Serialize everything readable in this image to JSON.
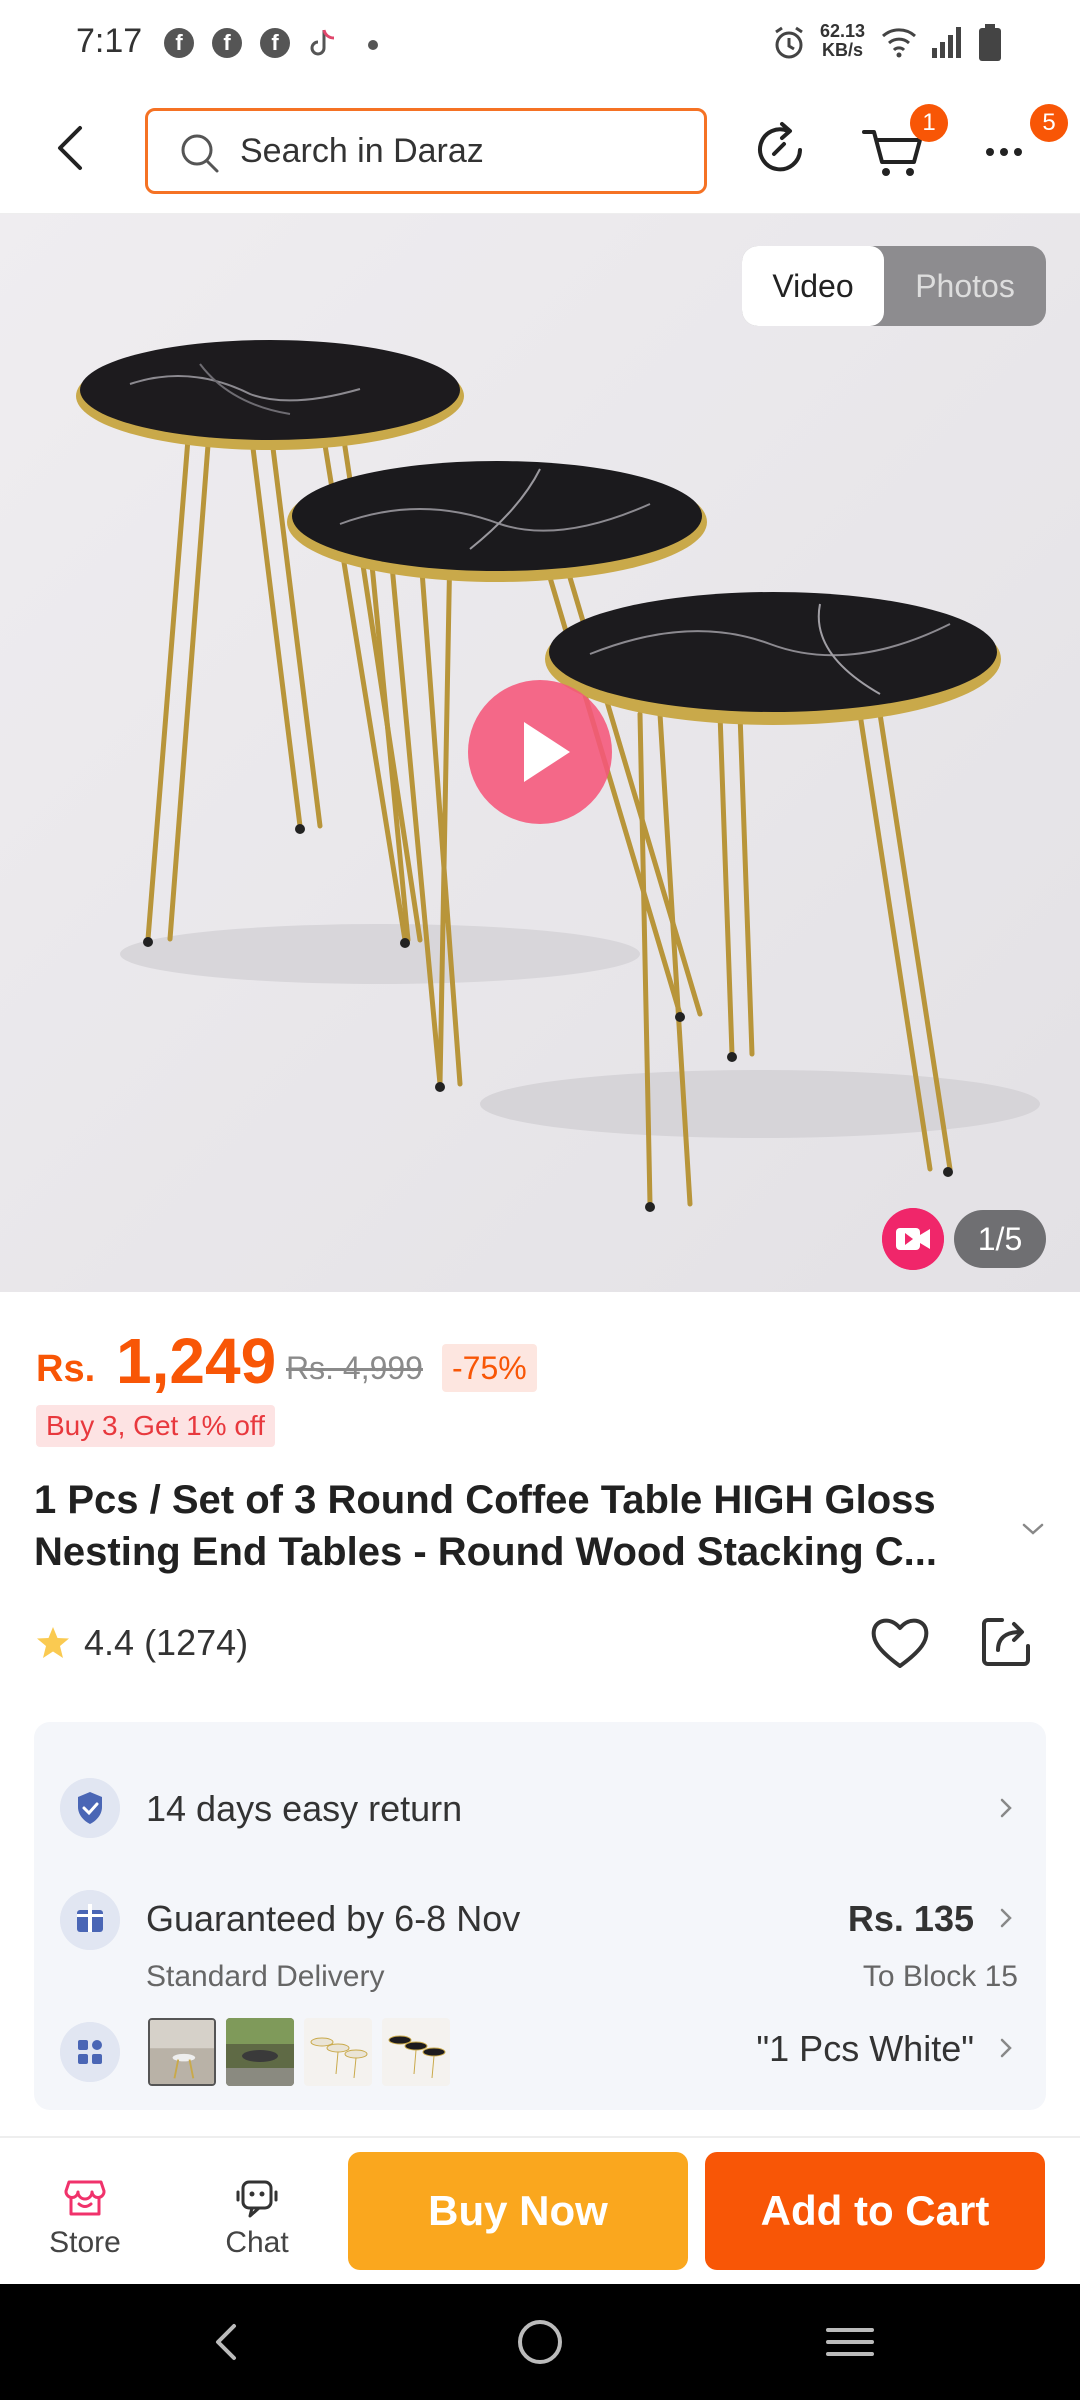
{
  "status_bar": {
    "time": "7:17",
    "net_speed_value": "62.13",
    "net_speed_unit": "KB/s",
    "notification_icons": [
      "facebook-icon",
      "facebook-icon",
      "facebook-icon",
      "tiktok-icon"
    ]
  },
  "header": {
    "search_placeholder": "Search in Daraz",
    "cart_badge": "1",
    "more_badge": "5"
  },
  "gallery": {
    "tab_video": "Video",
    "tab_photos": "Photos",
    "active_tab": "Video",
    "counter": "1/5"
  },
  "product": {
    "currency": "Rs.",
    "price": "1,249",
    "original_price": "Rs. 4,999",
    "discount": "-75%",
    "promo": "Buy 3, Get 1% off",
    "title": "1 Pcs / Set of 3 Round Coffee Table HIGH Gloss Nesting End Tables - Round Wood Stacking C...",
    "rating_value": "4.4",
    "rating_count": "(1274)"
  },
  "services": {
    "return_text": "14 days easy return",
    "delivery_text": "Guaranteed by 6-8 Nov",
    "delivery_sub": "Standard Delivery",
    "delivery_price": "Rs. 135",
    "delivery_to": "To Block 15",
    "variant_selected": "\"1 Pcs White\""
  },
  "actions": {
    "store_label": "Store",
    "chat_label": "Chat",
    "buy_now_label": "Buy Now",
    "add_to_cart_label": "Add to Cart"
  },
  "colors": {
    "brand_orange": "#f85606",
    "buy_now_yellow": "#faa71e",
    "play_pink": "#f5567a"
  }
}
